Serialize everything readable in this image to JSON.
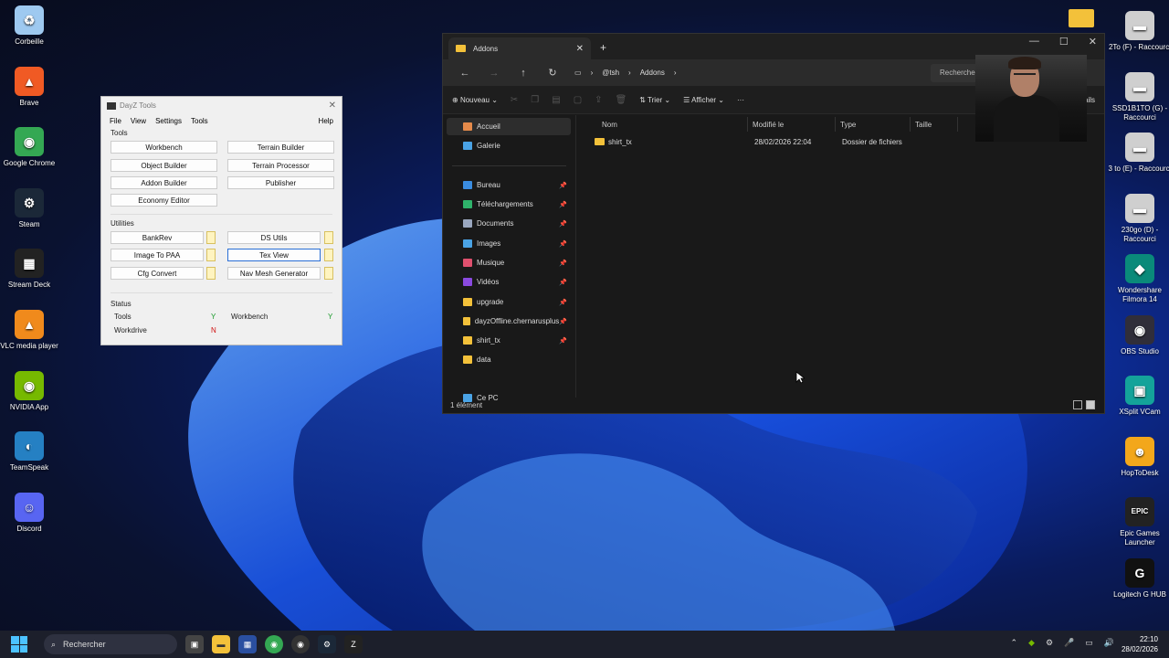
{
  "desktop_left": [
    {
      "label": "Corbeille",
      "icon": "recycle-bin-icon",
      "color": "#9ec9f0",
      "glyph": "♻"
    },
    {
      "label": "Brave",
      "icon": "brave-icon",
      "color": "#f05a24",
      "glyph": "▲"
    },
    {
      "label": "Google Chrome",
      "icon": "chrome-icon",
      "color": "#34a853",
      "glyph": "◉"
    },
    {
      "label": "Steam",
      "icon": "steam-icon",
      "color": "#1b2838",
      "glyph": "⚙"
    },
    {
      "label": "Stream Deck",
      "icon": "stream-deck-icon",
      "color": "#222",
      "glyph": "▦"
    },
    {
      "label": "VLC media player",
      "icon": "vlc-icon",
      "color": "#f08a1c",
      "glyph": "▲"
    },
    {
      "label": "NVIDIA App",
      "icon": "nvidia-icon",
      "color": "#76b900",
      "glyph": "◉"
    },
    {
      "label": "TeamSpeak",
      "icon": "teamspeak-icon",
      "color": "#2580c3",
      "glyph": "◐"
    },
    {
      "label": "Discord",
      "icon": "discord-icon",
      "color": "#5865f2",
      "glyph": "☺"
    }
  ],
  "desktop_right": [
    {
      "label": "2To (F) - Raccourci",
      "icon": "drive-icon",
      "color": "#cfcfcf",
      "glyph": "▬"
    },
    {
      "label": "SSD1B1TO (G) - Raccourci",
      "icon": "drive-icon",
      "color": "#cfcfcf",
      "glyph": "▬"
    },
    {
      "label": "3 to (E) - Raccourci",
      "icon": "drive-icon",
      "color": "#cfcfcf",
      "glyph": "▬"
    },
    {
      "label": "230go (D) - Raccourci",
      "icon": "drive-icon",
      "color": "#cfcfcf",
      "glyph": "▬"
    },
    {
      "label": "Wondershare Filmora 14",
      "icon": "filmora-icon",
      "color": "#0a8a7a",
      "glyph": "◆"
    },
    {
      "label": "OBS Studio",
      "icon": "obs-icon",
      "color": "#302e3a",
      "glyph": "◉"
    },
    {
      "label": "XSplit VCam",
      "icon": "xsplit-icon",
      "color": "#14a39a",
      "glyph": "▣"
    },
    {
      "label": "HopToDesk",
      "icon": "hoptodesk-icon",
      "color": "#f3a71b",
      "glyph": "☻"
    },
    {
      "label": "Epic Games Launcher",
      "icon": "epic-icon",
      "color": "#222",
      "glyph": "EPIC"
    },
    {
      "label": "Logitech G HUB",
      "icon": "logitech-icon",
      "color": "#111",
      "glyph": "G"
    }
  ],
  "dayz": {
    "title": "DayZ Tools",
    "menu": [
      "File",
      "View",
      "Settings",
      "Tools"
    ],
    "help": "Help",
    "tools_label": "Tools",
    "tools": [
      "Workbench",
      "Terrain Builder",
      "Object Builder",
      "Terrain Processor",
      "Addon Builder",
      "Publisher",
      "Economy Editor"
    ],
    "utilities_label": "Utilities",
    "utilities": [
      "BankRev",
      "DS Utils",
      "Image To PAA",
      "Tex View",
      "Cfg Convert",
      "Nav Mesh Generator"
    ],
    "status_label": "Status",
    "status": {
      "tools": "Tools",
      "tools_val": "Y",
      "workbench": "Workbench",
      "workbench_val": "Y",
      "workdrive": "Workdrive",
      "workdrive_val": "N"
    }
  },
  "explorer": {
    "tab": "Addons",
    "path": [
      "@tsh",
      "Addons"
    ],
    "search_placeholder": "Rechercher dans : Addons",
    "cmd": {
      "new": "Nouveau",
      "sort": "Trier",
      "view": "Afficher",
      "more": "···",
      "details": "Détails"
    },
    "sidebar": [
      {
        "label": "Accueil",
        "color": "#e58a4a",
        "pin": false,
        "active": true
      },
      {
        "label": "Galerie",
        "color": "#4aa3e5",
        "pin": false,
        "active": false
      },
      {
        "label": "Bureau",
        "color": "#3a8ce0",
        "pin": true,
        "active": false
      },
      {
        "label": "Téléchargements",
        "color": "#2fb36b",
        "pin": true,
        "active": false
      },
      {
        "label": "Documents",
        "color": "#9aa7bf",
        "pin": true,
        "active": false
      },
      {
        "label": "Images",
        "color": "#4aa3e5",
        "pin": true,
        "active": false
      },
      {
        "label": "Musique",
        "color": "#e0506e",
        "pin": true,
        "active": false
      },
      {
        "label": "Vidéos",
        "color": "#8a4ae0",
        "pin": true,
        "active": false
      },
      {
        "label": "upgrade",
        "color": "#f3c13a",
        "pin": true,
        "active": false
      },
      {
        "label": "dayzOffline.chernarusplus",
        "color": "#f3c13a",
        "pin": true,
        "active": false
      },
      {
        "label": "shirt_tx",
        "color": "#f3c13a",
        "pin": true,
        "active": false
      },
      {
        "label": "data",
        "color": "#f3c13a",
        "pin": false,
        "active": false
      },
      {
        "label": "Ce PC",
        "color": "#4aa3e5",
        "pin": false,
        "active": false
      }
    ],
    "columns": [
      "Nom",
      "Modifié le",
      "Type",
      "Taille"
    ],
    "rows": [
      {
        "name": "shirt_tx",
        "modified": "28/02/2026 22:04",
        "type": "Dossier de fichiers",
        "size": ""
      }
    ],
    "status": "1 élément"
  },
  "taskbar": {
    "search": "Rechercher",
    "time": "22:10",
    "date": "28/02/2026"
  }
}
